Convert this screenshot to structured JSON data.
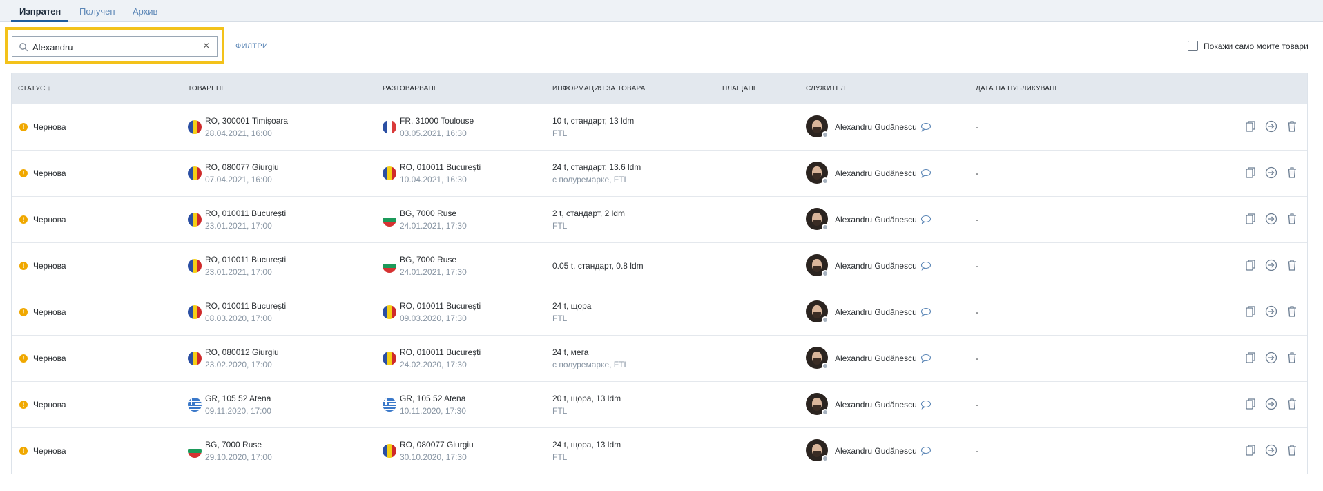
{
  "tabs": [
    {
      "label": "Изпратен"
    },
    {
      "label": "Получен"
    },
    {
      "label": "Архив"
    }
  ],
  "search": {
    "value": "Alexandru",
    "clear_label": "×"
  },
  "filters_label": "ФИЛТРИ",
  "only_mine_label": "Покажи само моите товари",
  "columns": {
    "status": "Статус ↓",
    "loading": "Товарене",
    "unloading": "Разтоварване",
    "info": "Информация за товара",
    "payment": "Плащане",
    "employee": "Служител",
    "published": "Дата на публикуване"
  },
  "colors": {
    "accent": "#1f5d9e",
    "highlight": "#f3c21a",
    "status_warning": "#f0a800",
    "link": "#5b86b6"
  },
  "rows": [
    {
      "status": "Чернова",
      "load_flag": "ro",
      "load_place": "RO, 300001 Timișoara",
      "load_date": "28.04.2021, 16:00",
      "unload_flag": "fr",
      "unload_place": "FR, 31000 Toulouse",
      "unload_date": "03.05.2021, 16:30",
      "info": "10 t, стандарт, 13 ldm",
      "info_sub": "FTL",
      "employee": "Alexandru Gudănescu",
      "published": "-"
    },
    {
      "status": "Чернова",
      "load_flag": "ro",
      "load_place": "RO, 080077 Giurgiu",
      "load_date": "07.04.2021, 16:00",
      "unload_flag": "ro",
      "unload_place": "RO, 010011 București",
      "unload_date": "10.04.2021, 16:30",
      "info": "24 t, стандарт, 13.6 ldm",
      "info_sub": "с полуремарке, FTL",
      "employee": "Alexandru Gudănescu",
      "published": "-"
    },
    {
      "status": "Чернова",
      "load_flag": "ro",
      "load_place": "RO, 010011 București",
      "load_date": "23.01.2021, 17:00",
      "unload_flag": "bg",
      "unload_place": "BG, 7000 Ruse",
      "unload_date": "24.01.2021, 17:30",
      "info": "2 t, стандарт, 2 ldm",
      "info_sub": "FTL",
      "employee": "Alexandru Gudănescu",
      "published": "-"
    },
    {
      "status": "Чернова",
      "load_flag": "ro",
      "load_place": "RO, 010011 București",
      "load_date": "23.01.2021, 17:00",
      "unload_flag": "bg",
      "unload_place": "BG, 7000 Ruse",
      "unload_date": "24.01.2021, 17:30",
      "info": "0.05 t, стандарт, 0.8 ldm",
      "info_sub": "",
      "employee": "Alexandru Gudănescu",
      "published": "-"
    },
    {
      "status": "Чернова",
      "load_flag": "ro",
      "load_place": "RO, 010011 București",
      "load_date": "08.03.2020, 17:00",
      "unload_flag": "ro",
      "unload_place": "RO, 010011 București",
      "unload_date": "09.03.2020, 17:30",
      "info": "24 t, щора",
      "info_sub": "FTL",
      "employee": "Alexandru Gudănescu",
      "published": "-"
    },
    {
      "status": "Чернова",
      "load_flag": "ro",
      "load_place": "RO, 080012 Giurgiu",
      "load_date": "23.02.2020, 17:00",
      "unload_flag": "ro",
      "unload_place": "RO, 010011 București",
      "unload_date": "24.02.2020, 17:30",
      "info": "24 t, мега",
      "info_sub": "с полуремарке, FTL",
      "employee": "Alexandru Gudănescu",
      "published": "-"
    },
    {
      "status": "Чернова",
      "load_flag": "gr",
      "load_place": "GR, 105 52 Atena",
      "load_date": "09.11.2020, 17:00",
      "unload_flag": "gr",
      "unload_place": "GR, 105 52 Atena",
      "unload_date": "10.11.2020, 17:30",
      "info": "20 t, щора, 13 ldm",
      "info_sub": "FTL",
      "employee": "Alexandru Gudănescu",
      "published": "-"
    },
    {
      "status": "Чернова",
      "load_flag": "bg",
      "load_place": "BG, 7000 Ruse",
      "load_date": "29.10.2020, 17:00",
      "unload_flag": "ro",
      "unload_place": "RO, 080077 Giurgiu",
      "unload_date": "30.10.2020, 17:30",
      "info": "24 t, щора, 13 ldm",
      "info_sub": "FTL",
      "employee": "Alexandru Gudănescu",
      "published": "-"
    }
  ]
}
